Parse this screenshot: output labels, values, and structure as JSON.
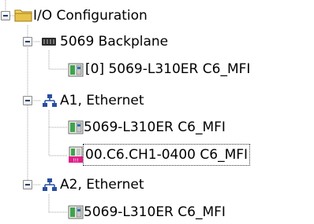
{
  "tree": {
    "root": {
      "label": "I/O Configuration",
      "icon": "folder-icon"
    },
    "backplane": {
      "label": "5069 Backplane",
      "icon": "backplane-icon",
      "children": [
        {
          "label": "[0] 5069-L310ER C6_MFI",
          "icon": "controller-module-icon"
        }
      ]
    },
    "a1": {
      "label": "A1, Ethernet",
      "icon": "network-icon",
      "children": [
        {
          "label": "5069-L310ER C6_MFI",
          "icon": "controller-module-icon"
        },
        {
          "label": "00.C6.CH1-0400 C6_MFI",
          "icon": "module-warning-icon"
        }
      ]
    },
    "a2": {
      "label": "A2, Ethernet",
      "icon": "network-icon",
      "children": [
        {
          "label": "5069-L310ER C6_MFI",
          "icon": "controller-module-icon"
        }
      ]
    }
  },
  "colors": {
    "folder": "#e8c24a",
    "module_green": "#3fa34d",
    "network": "#2a4fa0",
    "warning": "#e0218a"
  }
}
